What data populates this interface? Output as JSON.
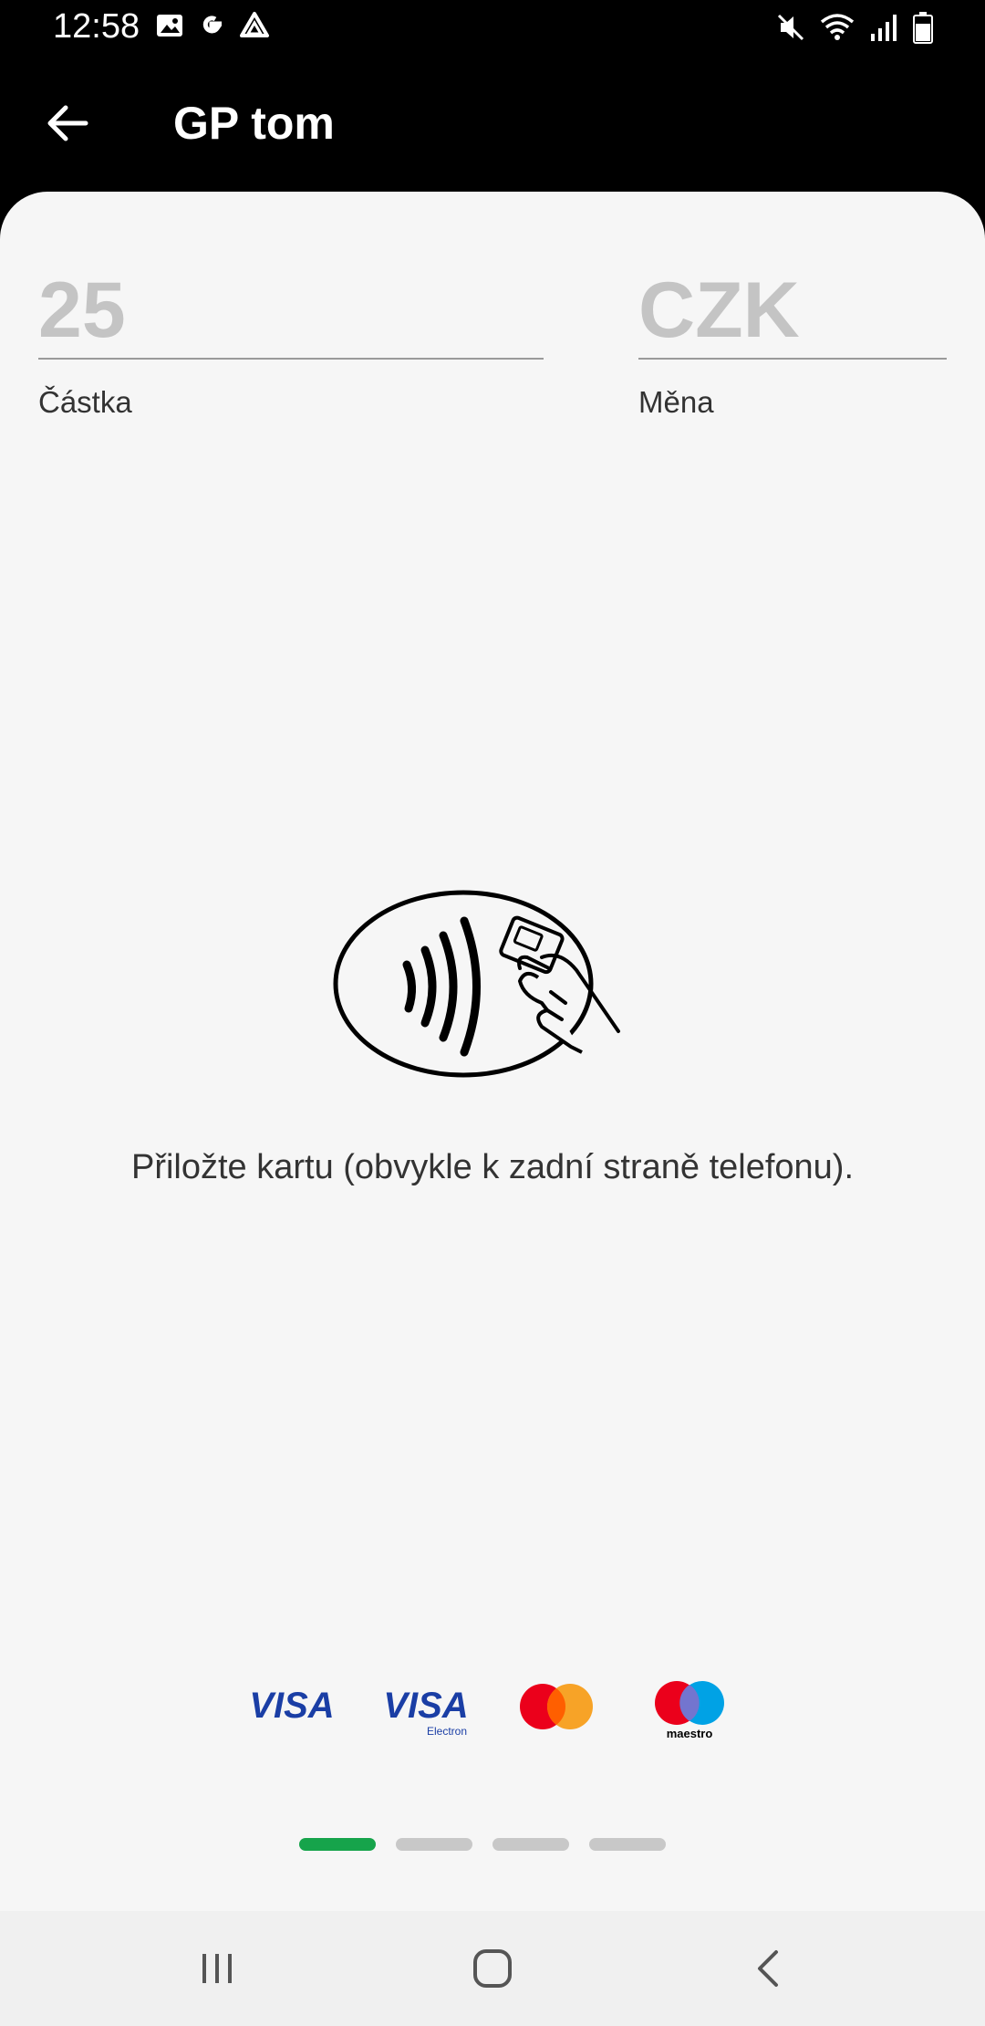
{
  "status_bar": {
    "time": "12:58",
    "left_icons": [
      "gallery-icon",
      "google-icon",
      "drive-icon"
    ],
    "right_icons": [
      "mute-icon",
      "wifi-icon",
      "signal-icon",
      "battery-icon"
    ]
  },
  "app_bar": {
    "back_icon": "arrow-left-icon",
    "title": "GP tom"
  },
  "payment": {
    "amount_value": "25",
    "amount_label": "Částka",
    "currency_value": "CZK",
    "currency_label": "Měna"
  },
  "instruction": "Přiložte kartu (obvykle k zadní straně telefonu).",
  "card_logos": {
    "visa": "VISA",
    "visa_electron": "VISA",
    "visa_electron_sub": "Electron",
    "maestro": "maestro"
  },
  "page_indicator": {
    "count": 4,
    "active_index": 0
  },
  "colors": {
    "accent": "#16a44b",
    "sheet_bg": "#f6f6f6",
    "header_bg": "#000000"
  },
  "nav_bar": [
    "recents-icon",
    "home-icon",
    "back-icon"
  ]
}
